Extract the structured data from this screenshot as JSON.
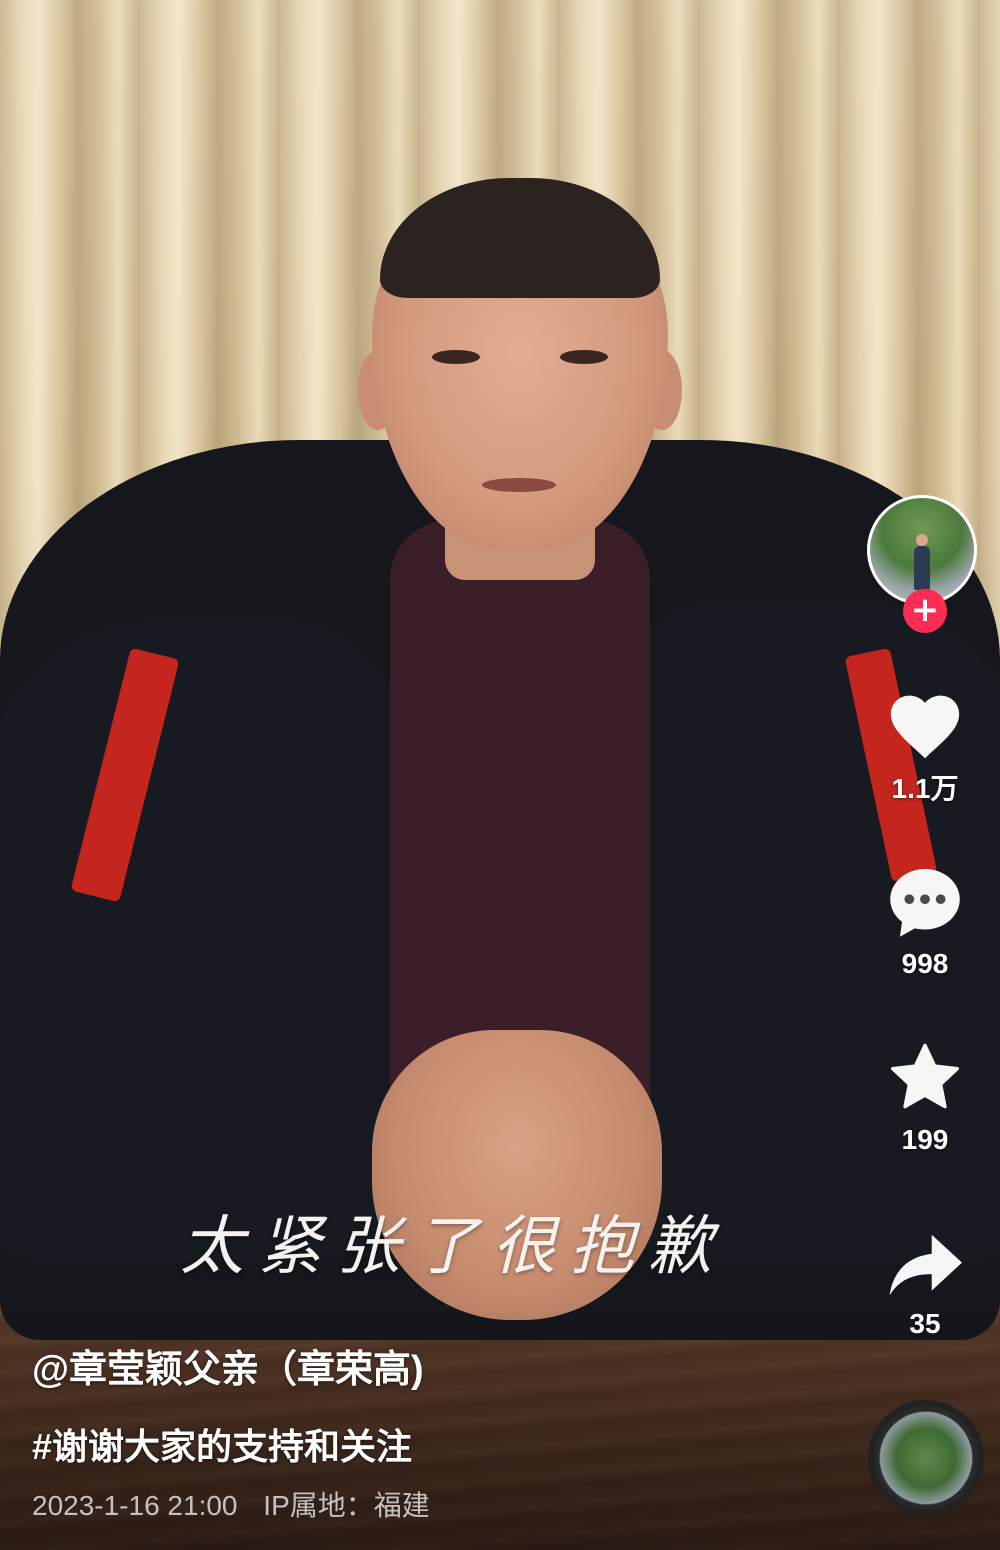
{
  "video": {
    "subtitle": "太紧张了很抱歉"
  },
  "actions": {
    "follow_symbol": "+",
    "like_count": "1.1万",
    "comment_count": "998",
    "favorite_count": "199",
    "share_count": "35"
  },
  "caption": {
    "author": "@章莹颖父亲（章荣高)",
    "hashtag": "#谢谢大家的支持和关注",
    "date": "2023-1-16 21:00",
    "ip_location": "IP属地：福建"
  },
  "icons": {
    "like": "heart-icon",
    "comment": "comment-bubble-icon",
    "favorite": "star-icon",
    "share": "share-arrow-icon",
    "follow": "plus-icon"
  },
  "colors": {
    "accent": "#fe2c55",
    "text": "#ffffff"
  }
}
